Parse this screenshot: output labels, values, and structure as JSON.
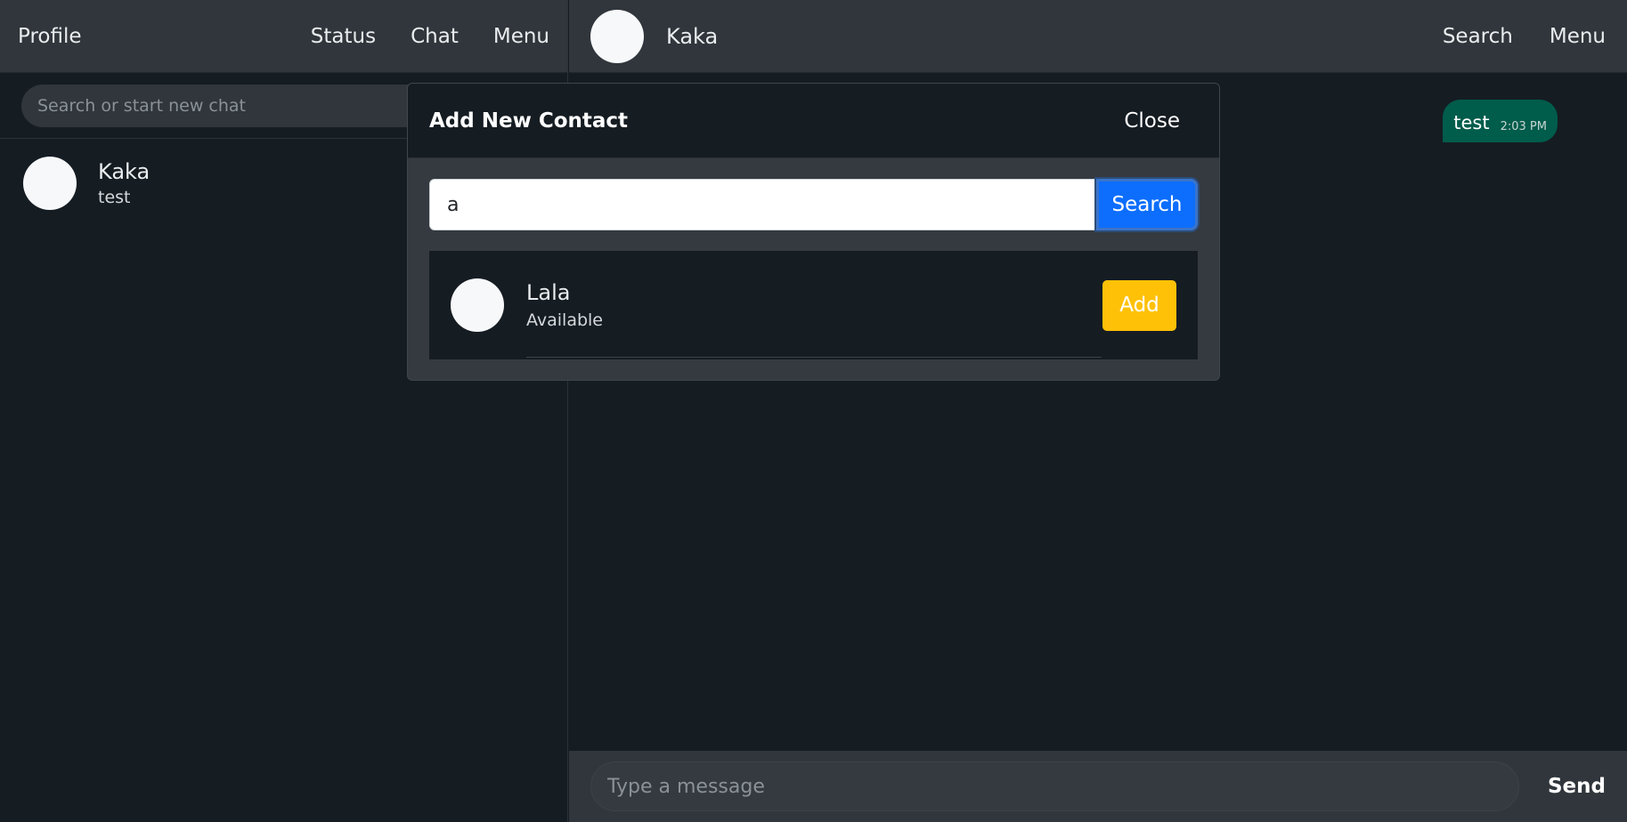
{
  "left_header": {
    "profile": "Profile",
    "nav": [
      "Status",
      "Chat",
      "Menu"
    ]
  },
  "sidebar": {
    "search_placeholder": "Search or start new chat",
    "chats": [
      {
        "name": "Kaka",
        "last_message": "test"
      }
    ]
  },
  "chat_header": {
    "contact_name": "Kaka",
    "nav": [
      "Search",
      "Menu"
    ]
  },
  "messages": [
    {
      "text": "test",
      "time": "2:03 PM",
      "outgoing": true
    }
  ],
  "composer": {
    "placeholder": "Type a message",
    "send_label": "Send"
  },
  "modal": {
    "title": "Add New Contact",
    "close_label": "Close",
    "search_value": "a",
    "search_button": "Search",
    "results": [
      {
        "name": "Lala",
        "status": "Available",
        "add_label": "Add"
      }
    ]
  },
  "colors": {
    "background": "#151c22",
    "header": "#30363b",
    "outgoing_bubble": "#005c4b",
    "primary": "#0d6efd",
    "warning": "#ffc107"
  }
}
